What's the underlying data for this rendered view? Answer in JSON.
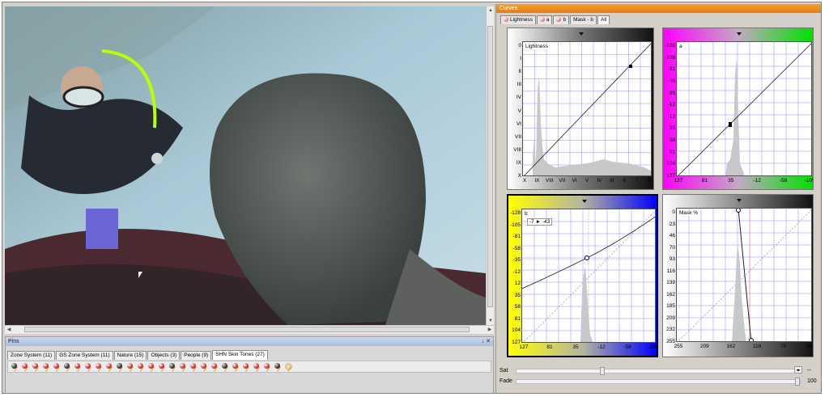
{
  "pins": {
    "title": "Pins",
    "controls": "↓ ✕",
    "tabs": [
      {
        "label": "Zone System (11)"
      },
      {
        "label": "GS Zone System (11)"
      },
      {
        "label": "Nature (15)"
      },
      {
        "label": "Objects (3)"
      },
      {
        "label": "People (9)"
      },
      {
        "label": "SHN Skin Tones (27)"
      }
    ],
    "active_tab": "SHN Skin Tones (27)",
    "pin_count": 27
  },
  "curves": {
    "title": "Curves",
    "tabs": [
      {
        "label": "Lightness"
      },
      {
        "label": "a"
      },
      {
        "label": "b"
      },
      {
        "label": "Mask - b"
      },
      {
        "label": "All"
      }
    ],
    "active_tab": "All",
    "panels": {
      "lightness": {
        "label": "Lightness",
        "y_ticks": [
          "0",
          "I",
          "II",
          "III",
          "IV",
          "V",
          "VI",
          "VII",
          "VIII",
          "IX",
          "X"
        ],
        "x_ticks": [
          "X",
          "IX",
          "VIII",
          "VII",
          "VI",
          "V",
          "IV",
          "III",
          "II",
          "I",
          "0"
        ]
      },
      "a": {
        "label": "a",
        "y_ticks": [
          "-128",
          "-106",
          "-81",
          "-58",
          "-35",
          "-12",
          "12",
          "35",
          "58",
          "81",
          "104",
          "127"
        ],
        "x_ticks": [
          "127",
          "81",
          "35",
          "-12",
          "-58",
          "-105"
        ]
      },
      "b": {
        "label": "b",
        "readout_in": "-7",
        "readout_out": "-43",
        "y_ticks": [
          "-128",
          "-105",
          "-81",
          "-58",
          "-35",
          "-12",
          "12",
          "35",
          "58",
          "81",
          "104",
          "127"
        ],
        "x_ticks": [
          "127",
          "81",
          "35",
          "-12",
          "-58",
          "-105"
        ]
      },
      "mask": {
        "label": "Mask %",
        "y_ticks": [
          "0",
          "23",
          "46",
          "70",
          "93",
          "116",
          "139",
          "162",
          "185",
          "209",
          "232",
          "255"
        ],
        "x_ticks": [
          "255",
          "209",
          "162",
          "116",
          "70",
          "23"
        ]
      }
    },
    "sat": {
      "label": "Sat",
      "value": "--",
      "position": 0.3
    },
    "fade": {
      "label": "Fade",
      "value": "100",
      "position": 1.0
    }
  },
  "colors": {
    "curves_title_bar": "#f39018",
    "pins_title_bar": "#b5c8e3",
    "grid": "#7878ff",
    "magenta": "#ff00ff",
    "green": "#00e000",
    "yellow": "#ffff00",
    "blue": "#0000ff"
  }
}
